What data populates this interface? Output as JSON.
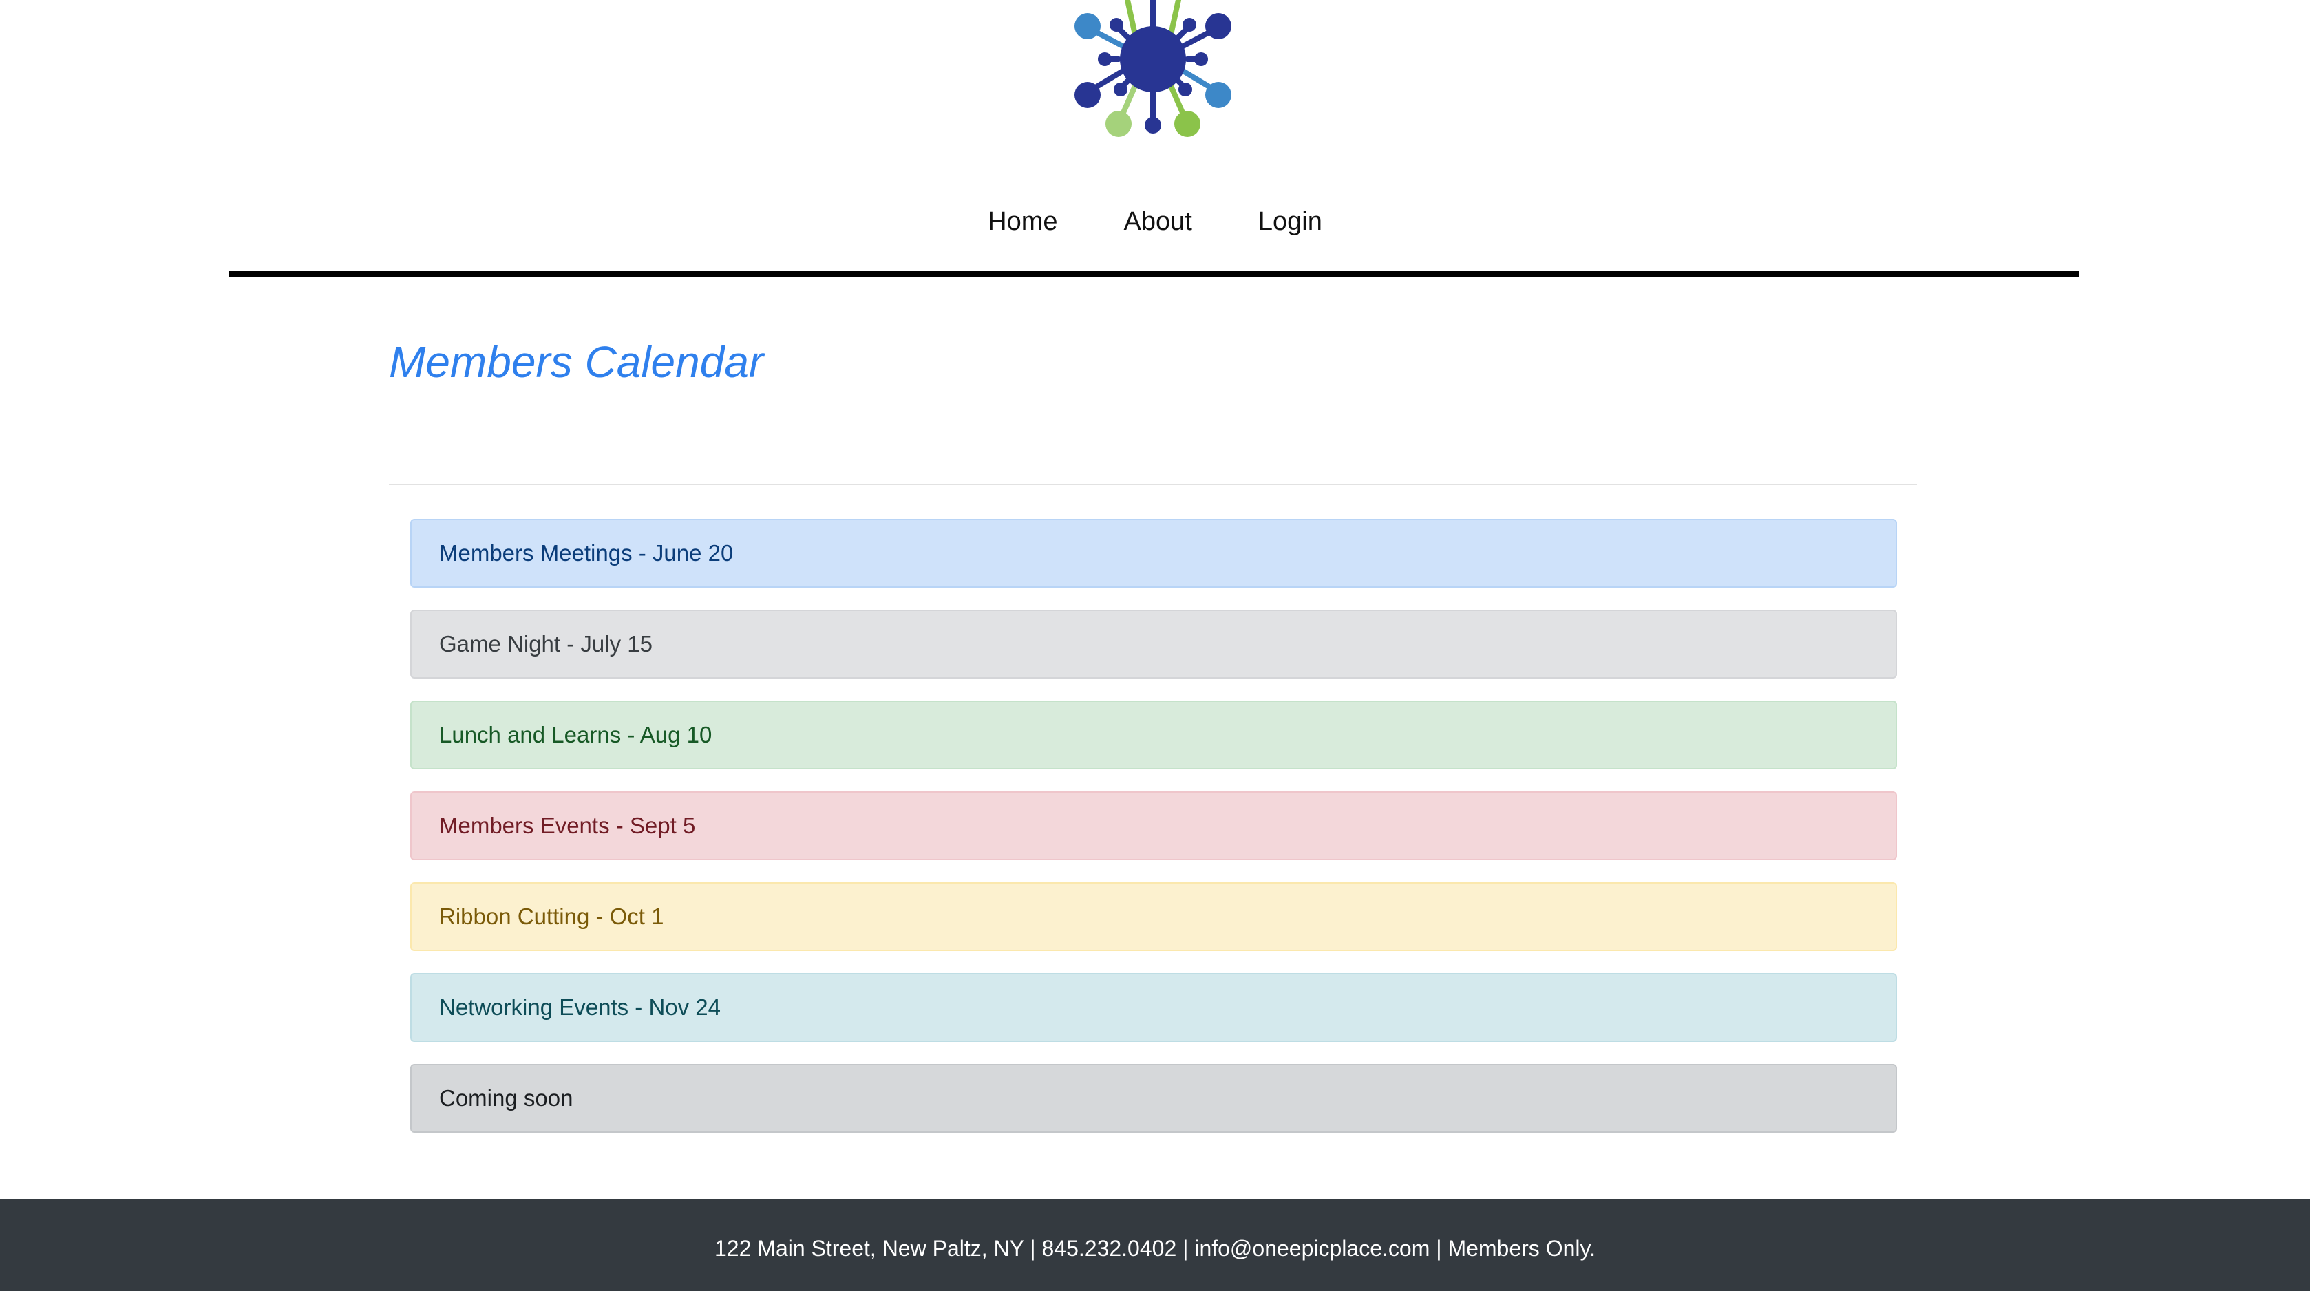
{
  "nav": {
    "items": [
      {
        "label": "Home"
      },
      {
        "label": "About"
      },
      {
        "label": "Login"
      }
    ]
  },
  "main": {
    "title": "Members Calendar",
    "events": [
      {
        "label": "Members Meetings - June 20",
        "color": "#cfe2fa"
      },
      {
        "label": "Game Night - July 15",
        "color": "#e1e2e4"
      },
      {
        "label": "Lunch and Learns - Aug 10",
        "color": "#d8ebdb"
      },
      {
        "label": "Members Events - Sept 5",
        "color": "#f3d7da"
      },
      {
        "label": "Ribbon Cutting - Oct 1",
        "color": "#fcf1cf"
      },
      {
        "label": "Networking Events - Nov 24",
        "color": "#d4e9ed"
      },
      {
        "label": "Coming soon",
        "color": "#d6d8da"
      }
    ]
  },
  "footer": {
    "text": "122 Main Street, New Paltz, NY | 845.232.0402 | info@oneepicplace.com | Members Only."
  },
  "colors": {
    "title_accent": "#2f80ed",
    "footer_bg": "#343a40",
    "logo_navy": "#283593",
    "logo_blue": "#3d88c8",
    "logo_green": "#8bc34a"
  },
  "icons": {
    "logo": "network-hub-logo-icon"
  }
}
